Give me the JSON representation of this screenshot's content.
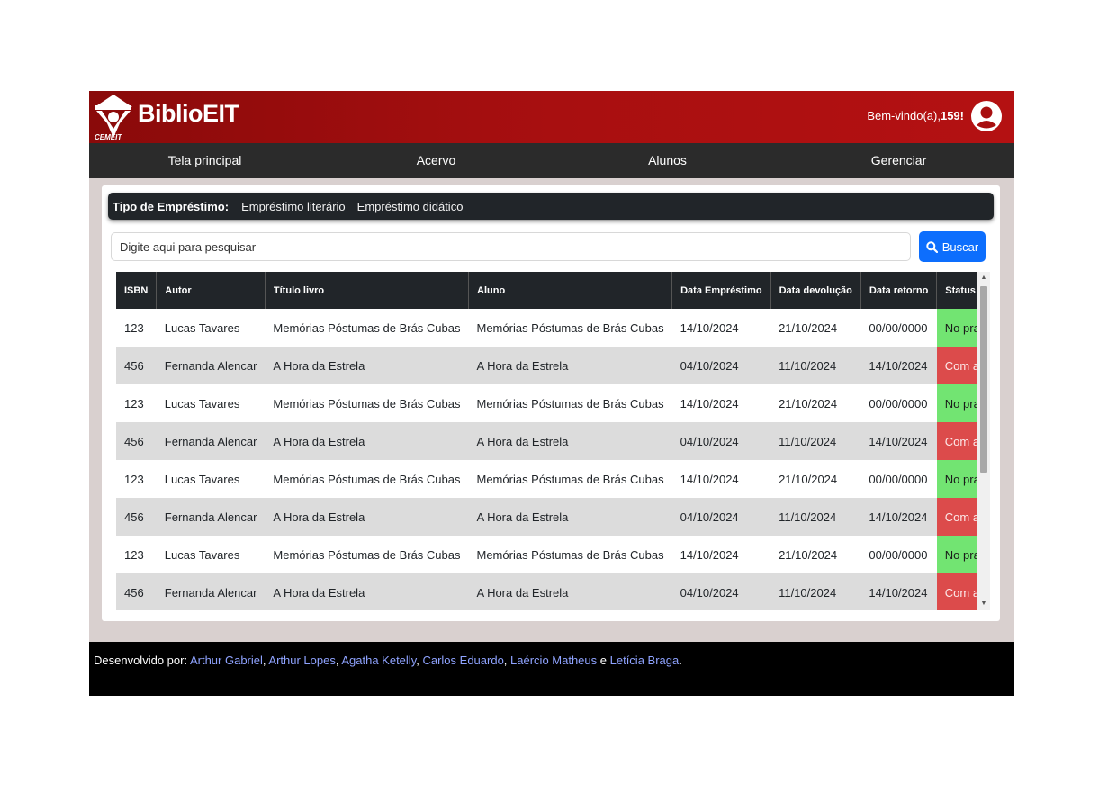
{
  "header": {
    "logo_text": "CEMEIT",
    "brand": "BiblioEIT",
    "welcome_prefix": "Bem-vindo(a),",
    "welcome_user": "159!",
    "colors": {
      "header_red": "#a80f10",
      "nav_dark": "#2b2b2b"
    }
  },
  "nav": {
    "items": [
      {
        "label": "Tela principal"
      },
      {
        "label": "Acervo"
      },
      {
        "label": "Alunos"
      },
      {
        "label": "Gerenciar"
      }
    ]
  },
  "filter": {
    "label": "Tipo de Empréstimo:",
    "options": [
      "Empréstimo literário",
      "Empréstimo didático"
    ]
  },
  "search": {
    "placeholder": "Digite aqui para pesquisar",
    "button_label": "Buscar",
    "button_color": "#0d6efd"
  },
  "table": {
    "headers": [
      "ISBN",
      "Autor",
      "Título livro",
      "Aluno",
      "Data Empréstimo",
      "Data devolução",
      "Data retorno",
      "Status"
    ],
    "rows": [
      [
        "123",
        "Lucas Tavares",
        "Memórias Póstumas de Brás Cubas",
        "Memórias Póstumas de Brás Cubas",
        "14/10/2024",
        "21/10/2024",
        "00/00/0000",
        "No prazo"
      ],
      [
        "456",
        "Fernanda Alencar",
        "A Hora da Estrela",
        "A Hora da Estrela",
        "04/10/2024",
        "11/10/2024",
        "14/10/2024",
        "Com atraso"
      ],
      [
        "123",
        "Lucas Tavares",
        "Memórias Póstumas de Brás Cubas",
        "Memórias Póstumas de Brás Cubas",
        "14/10/2024",
        "21/10/2024",
        "00/00/0000",
        "No prazo"
      ],
      [
        "456",
        "Fernanda Alencar",
        "A Hora da Estrela",
        "A Hora da Estrela",
        "04/10/2024",
        "11/10/2024",
        "14/10/2024",
        "Com atraso"
      ],
      [
        "123",
        "Lucas Tavares",
        "Memórias Póstumas de Brás Cubas",
        "Memórias Póstumas de Brás Cubas",
        "14/10/2024",
        "21/10/2024",
        "00/00/0000",
        "No prazo"
      ],
      [
        "456",
        "Fernanda Alencar",
        "A Hora da Estrela",
        "A Hora da Estrela",
        "04/10/2024",
        "11/10/2024",
        "14/10/2024",
        "Com atraso"
      ],
      [
        "123",
        "Lucas Tavares",
        "Memórias Póstumas de Brás Cubas",
        "Memórias Póstumas de Brás Cubas",
        "14/10/2024",
        "21/10/2024",
        "00/00/0000",
        "No prazo"
      ],
      [
        "456",
        "Fernanda Alencar",
        "A Hora da Estrela",
        "A Hora da Estrela",
        "04/10/2024",
        "11/10/2024",
        "14/10/2024",
        "Com atraso"
      ]
    ],
    "status_colors": {
      "No prazo": "#72e472",
      "Com atraso": "#dc4b4b"
    }
  },
  "footer": {
    "prefix": "Desenvolvido por:",
    "authors": [
      "Arthur Gabriel",
      "Arthur Lopes",
      "Agatha Ketelly",
      "Carlos Eduardo",
      "Laércio Matheus",
      "Letícia Braga"
    ],
    "sep": ", ",
    "conj": " e ",
    "end": "."
  }
}
